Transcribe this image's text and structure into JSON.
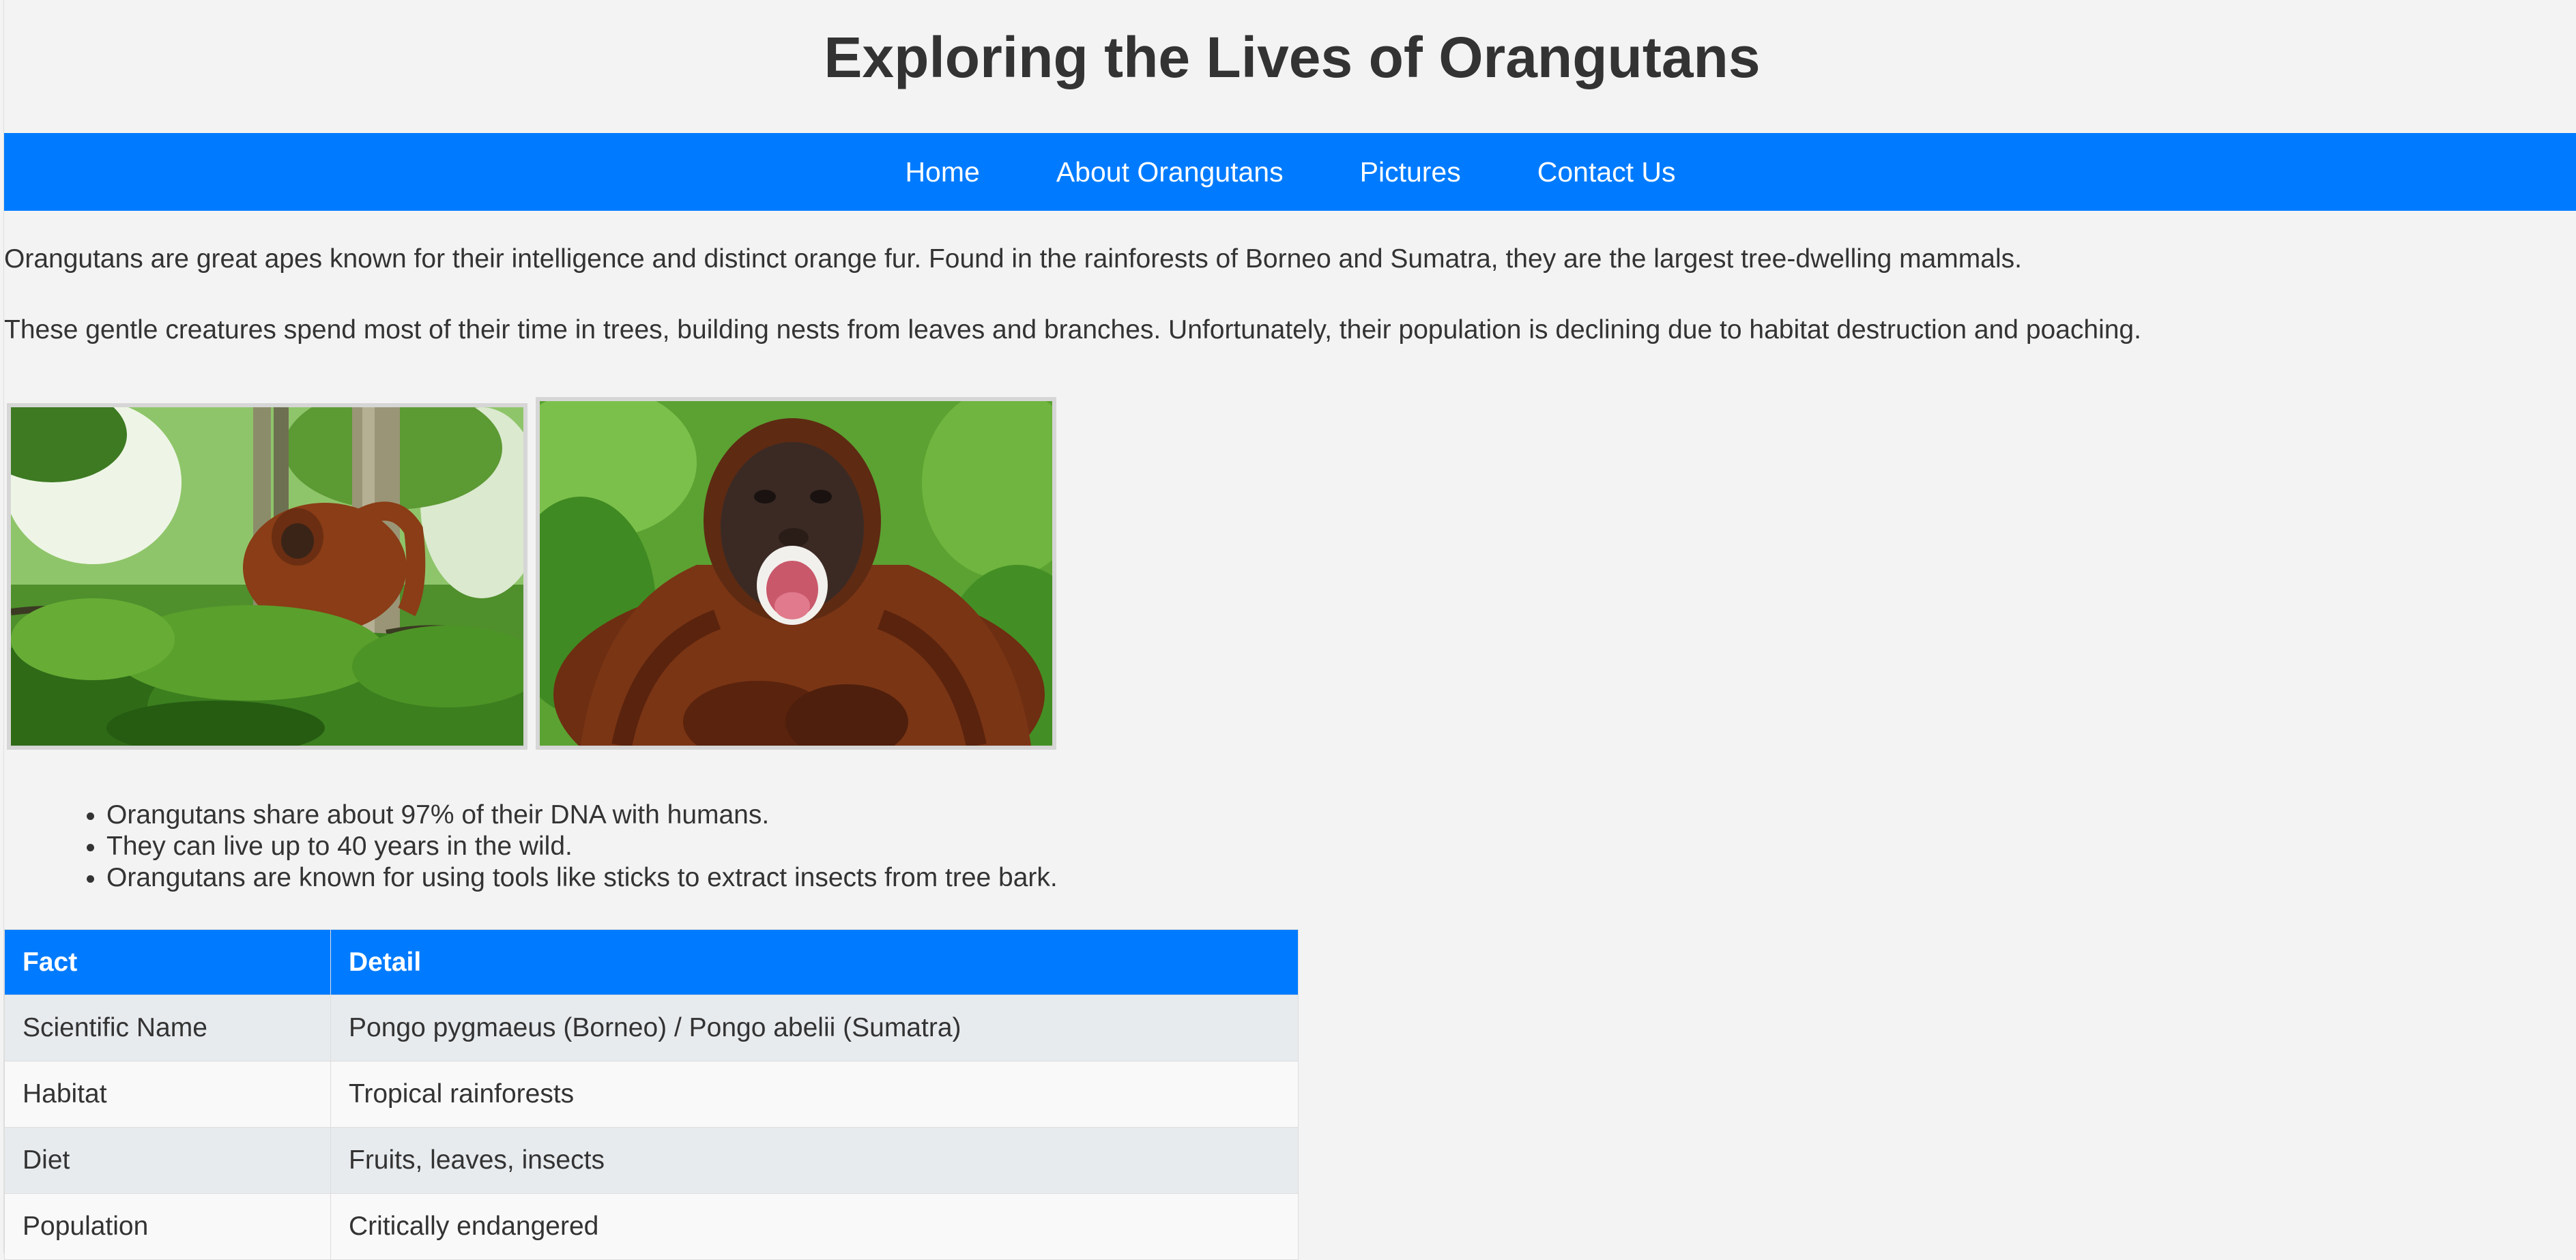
{
  "header": {
    "title": "Exploring the Lives of Orangutans"
  },
  "nav": {
    "items": [
      {
        "label": "Home"
      },
      {
        "label": "About Orangutans"
      },
      {
        "label": "Pictures"
      },
      {
        "label": "Contact Us"
      }
    ]
  },
  "intro": {
    "paragraph_1": "Orangutans are great apes known for their intelligence and distinct orange fur. Found in the rainforests of Borneo and Sumatra, they are the largest tree-dwelling mammals.",
    "paragraph_2": "These gentle creatures spend most of their time in trees, building nests from leaves and branches. Unfortunately, their population is declining due to habitat destruction and poaching."
  },
  "facts_list": [
    "Orangutans share about 97% of their DNA with humans.",
    "They can live up to 40 years in the wild.",
    "Orangutans are known for using tools like sticks to extract insects from tree bark."
  ],
  "facts_table": {
    "headers": [
      "Fact",
      "Detail"
    ],
    "rows": [
      [
        "Scientific Name",
        "Pongo pygmaeus (Borneo) / Pongo abelii (Sumatra)"
      ],
      [
        "Habitat",
        "Tropical rainforests"
      ],
      [
        "Diet",
        "Fruits, leaves, insects"
      ],
      [
        "Population",
        "Critically endangered"
      ]
    ]
  },
  "colors": {
    "accent": "#007bff",
    "background": "#f3f3f3",
    "text": "#333333",
    "row_odd": "#e8ebee",
    "row_even": "#f9f9f9"
  }
}
